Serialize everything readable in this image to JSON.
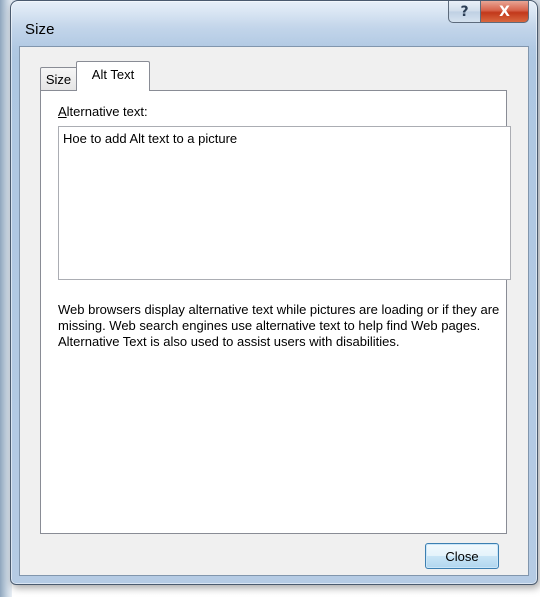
{
  "window": {
    "title": "Size",
    "help_glyph": "?",
    "close_glyph": "X"
  },
  "tabs": [
    {
      "label": "Size",
      "selected": false
    },
    {
      "label": "Alt Text",
      "selected": true
    }
  ],
  "alt_text": {
    "label_accel": "A",
    "label_rest": "lternative text:",
    "value": "Hoe to add Alt text to a picture",
    "help": "Web browsers display alternative text while pictures are loading or if they are missing.  Web search engines use alternative text to help find Web pages.  Alternative Text is also used to assist users with disabilities."
  },
  "buttons": {
    "close_label": "Close"
  }
}
